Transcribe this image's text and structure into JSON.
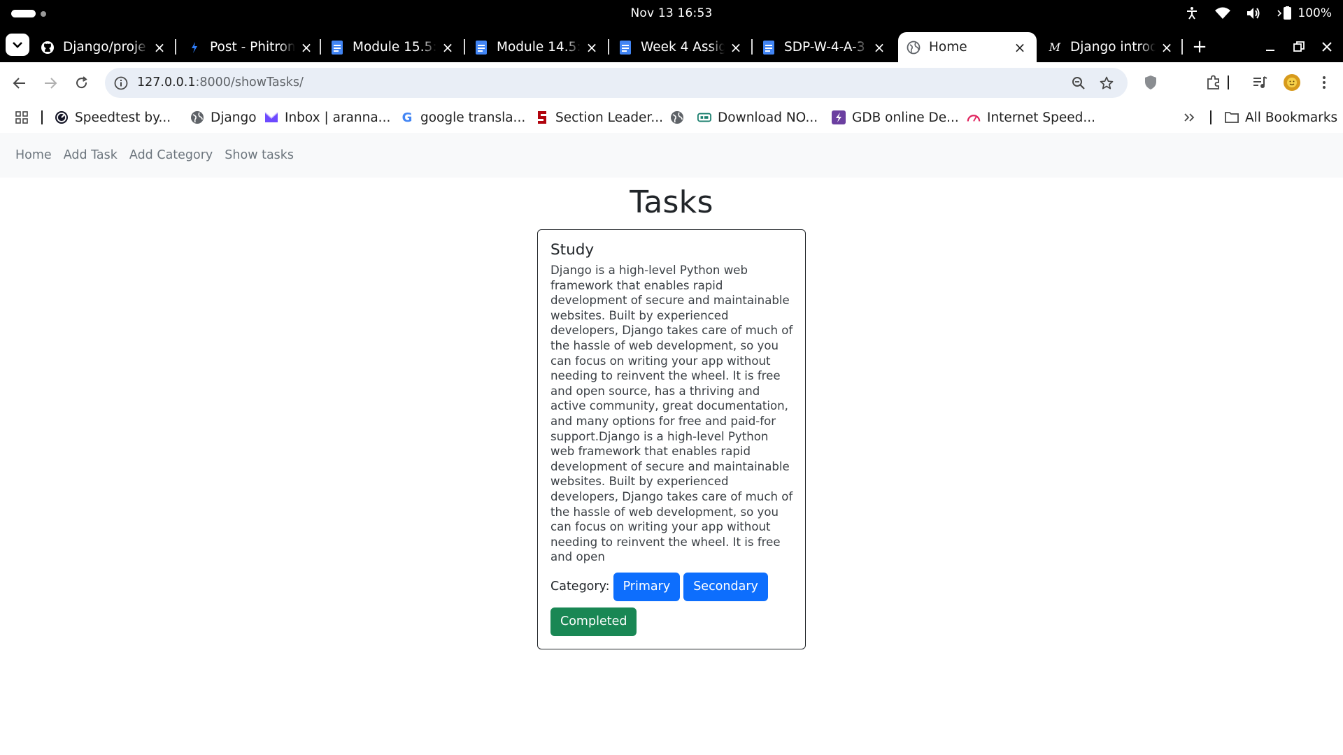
{
  "system": {
    "clock": "Nov 13  16:53",
    "battery": "100%"
  },
  "tabs": [
    {
      "title": "Django/proje",
      "icon": "github-icon"
    },
    {
      "title": "Post - Phitron",
      "icon": "phitron-icon"
    },
    {
      "title": "Module 15.5: ",
      "icon": "google-docs-icon"
    },
    {
      "title": "Module 14.5: ",
      "icon": "google-docs-icon"
    },
    {
      "title": "Week 4 Assign",
      "icon": "google-docs-icon"
    },
    {
      "title": "SDP-W-4-A-3",
      "icon": "google-docs-icon"
    },
    {
      "title": "Home",
      "icon": "globe-icon",
      "active": true
    },
    {
      "title": "Django introd",
      "icon": "medium-icon"
    }
  ],
  "omnibox": {
    "host": "127.0.0.1",
    "path": ":8000/showTasks/"
  },
  "bookmarks": [
    {
      "label": "Speedtest by...",
      "icon": "speedtest-icon"
    },
    {
      "label": "Django",
      "icon": "globe-icon"
    },
    {
      "label": "Inbox | aranna...",
      "icon": "proton-mail-icon"
    },
    {
      "label": "google transla...",
      "icon": "google-icon"
    },
    {
      "label": "Section Leader...",
      "icon": "stanford-icon"
    },
    {
      "label": "",
      "icon": "globe-icon"
    },
    {
      "label": "Download NO...",
      "icon": "download-icon"
    },
    {
      "label": "GDB online De...",
      "icon": "gdb-icon"
    },
    {
      "label": "Internet Speed...",
      "icon": "speed-gauge-icon"
    }
  ],
  "all_bookmarks": "All Bookmarks",
  "site_nav": [
    "Home",
    "Add Task",
    "Add Category",
    "Show tasks"
  ],
  "page": {
    "title": "Tasks",
    "task": {
      "title": "Study",
      "description": "Django is a high-level Python web framework that enables rapid development of secure and maintainable websites. Built by experienced developers, Django takes care of much of the hassle of web development, so you can focus on writing your app without needing to reinvent the wheel. It is free and open source, has a thriving and active community, great documentation, and many options for free and paid-for support.Django is a high-level Python web framework that enables rapid development of secure and maintainable websites. Built by experienced developers, Django takes care of much of the hassle of web development, so you can focus on writing your app without needing to reinvent the wheel. It is free and open",
      "category_label": "Category:",
      "categories": [
        "Primary",
        "Secondary"
      ],
      "status": "Completed"
    }
  },
  "colors": {
    "primary": "#0d6efd",
    "success": "#198754",
    "navbar_bg": "#f8f9fa",
    "omnibox_bg": "#e9eef6"
  }
}
